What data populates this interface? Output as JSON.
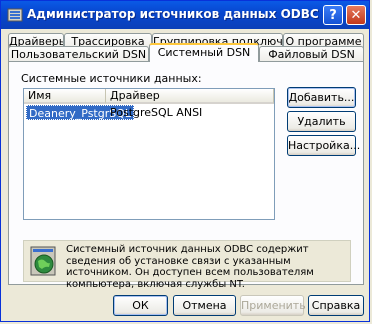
{
  "window": {
    "title": "Администратор источников данных ODBC",
    "help_glyph": "?",
    "close_glyph": "✕"
  },
  "tabs_row1": [
    {
      "label": "Драйверы"
    },
    {
      "label": "Трассировка"
    },
    {
      "label": "Группировка подключений"
    },
    {
      "label": "О программе"
    }
  ],
  "tabs_row2": [
    {
      "label": "Пользовательский DSN"
    },
    {
      "label": "Системный DSN",
      "active": true
    },
    {
      "label": "Файловый DSN"
    }
  ],
  "panel": {
    "section_label": "Системные источники данных:",
    "columns": [
      "Имя",
      "Драйвер"
    ],
    "rows": [
      {
        "name": "Deanery_PstgrSQL",
        "driver": "PostgreSQL ANSI",
        "selected": true
      }
    ],
    "buttons": {
      "add": "Добавить...",
      "remove": "Удалить",
      "configure": "Настройка..."
    },
    "info_text": "Системный источник данных ODBC содержит сведения об установке связи с указанным источником. Он доступен всем пользователям компьютера, включая службы NT."
  },
  "footer": {
    "ok": "ОК",
    "cancel": "Отмена",
    "apply": "Применить",
    "help": "Справка"
  },
  "colors": {
    "titlebar": "#0a4fd8",
    "selection": "#316ac5",
    "active_tab_accent": "#ffc83c"
  }
}
